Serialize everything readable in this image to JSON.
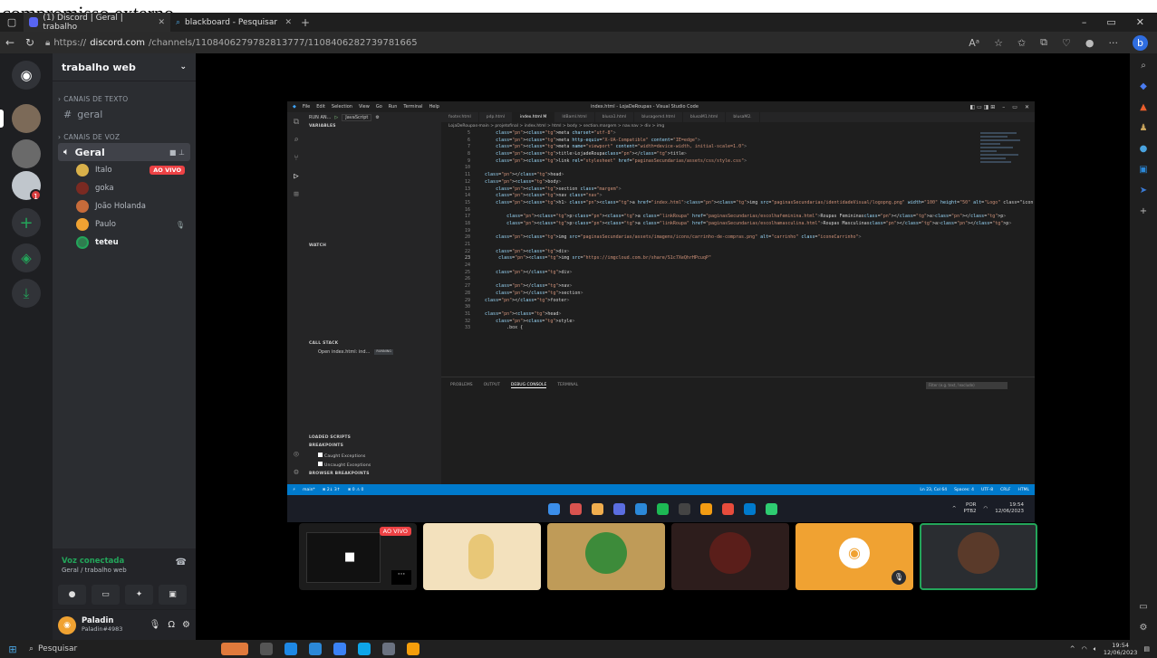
{
  "clip_text": "compromisso externo.",
  "browser": {
    "tabs": [
      {
        "label": "(1) Discord | Geral | trabalho",
        "active": true
      },
      {
        "label": "blackboard - Pesquisar",
        "active": false
      }
    ],
    "url_prefix": "https://",
    "url_domain": "discord.com",
    "url_path": "/channels/1108406279782813777/1108406282739781665"
  },
  "discord": {
    "server_name": "trabalho web",
    "text_category": "CANAIS DE TEXTO",
    "text_channels": [
      {
        "name": "geral"
      }
    ],
    "voice_category": "CANAIS DE VOZ",
    "voice_channel": {
      "name": "Geral",
      "live_label": "AO VIVO"
    },
    "voice_users": [
      {
        "name": "Italo",
        "live": true,
        "color": "#d9b14a"
      },
      {
        "name": "goka",
        "live": false,
        "color": "#7a2a22"
      },
      {
        "name": "João Holanda",
        "live": false,
        "color": "#c76b3a"
      },
      {
        "name": "Paulo",
        "live": false,
        "muted": true,
        "color": "#f0a232"
      },
      {
        "name": "teteu",
        "live": false,
        "color": "#2f7d4f"
      }
    ],
    "server_badge": "1",
    "voice_status": {
      "title": "Voz conectada",
      "subtitle": "Geral / trabalho web"
    },
    "user": {
      "name": "Paladin",
      "tag": "Paladin#4983"
    }
  },
  "vscode": {
    "window_title": "index.html - LojaDeRoupas - Visual Studio Code",
    "menu": [
      "File",
      "Edit",
      "Selection",
      "View",
      "Go",
      "Run",
      "Terminal",
      "Help"
    ],
    "run_label": "RUN AN...",
    "run_config": "JavaScript",
    "tabs": [
      "footer.html",
      "pdp.html",
      "index.html M",
      "IdBaml.html",
      "blusa1.html",
      "blusagemd.html",
      "blusaM1.html",
      "blusaM2."
    ],
    "breadcrumb": "LojaDeRoupas-main > projetofinal > index.html > html > body > section.margem > nav.nav > div > img",
    "sections": {
      "variables": "VARIABLES",
      "watch": "WATCH",
      "call_stack": "CALL STACK",
      "loaded_scripts": "LOADED SCRIPTS",
      "breakpoints": "BREAKPOINTS",
      "browser_breakpoints": "BROWSER BREAKPOINTS"
    },
    "call_stack_item": "Open index.html: ind...",
    "call_stack_state": "RUNNING",
    "bp_caught": "Caught Exceptions",
    "bp_uncaught": "Uncaught Exceptions",
    "code_lines": [
      {
        "n": "5",
        "t": "      <meta charset=\"utf-8\">"
      },
      {
        "n": "6",
        "t": "      <meta http-equiv=\"X-UA-Compatible\" content=\"IE=edge\">"
      },
      {
        "n": "7",
        "t": "      <meta name=\"viewport\" content=\"width=device-width, initial-scale=1.0\">"
      },
      {
        "n": "8",
        "t": "      <title>LojadeRoupa</title>"
      },
      {
        "n": "9",
        "t": "      <link rel=\"stylesheet\" href=\"paginasSecundarias/assets/css/style.css\">"
      },
      {
        "n": "10",
        "t": ""
      },
      {
        "n": "11",
        "t": "  </head>"
      },
      {
        "n": "12",
        "t": "  <body>"
      },
      {
        "n": "13",
        "t": "      <section class=\"margem\">"
      },
      {
        "n": "14",
        "t": "      <nav class=\"nav\">"
      },
      {
        "n": "15",
        "t": "      <h1> <a href=\"index.html\"><img src=\"paginasSecundarias/identidadeVisual/logopng.png\" width=\"100\" height=\"50\" alt=\"Logo\" class=\"icon"
      },
      {
        "n": "16",
        "t": ""
      },
      {
        "n": "17",
        "t": "          <p><a class=\"linkRoupa\" href=\"paginasSecundarias/escolhafeminina.html\">Roupas Femininas</a></p>"
      },
      {
        "n": "18",
        "t": "          <p><a class=\"linkRoupa\" href=\"paginasSecundarias/escolhamasculina.html\">Roupas Masculinas</a></p>"
      },
      {
        "n": "19",
        "t": ""
      },
      {
        "n": "20",
        "t": "      <img src=\"paginasSecundarias/assets/imagens/icons/carrinho-de-compras.png\" alt=\"carrinho\" class=\"iconeCarrinho\">"
      },
      {
        "n": "21",
        "t": ""
      },
      {
        "n": "22",
        "t": "      <div>"
      },
      {
        "n": "23",
        "t": "       <img src=\"https://imgcloud.com.br/share/S1c7XeQhrHPcuqP\""
      },
      {
        "n": "24",
        "t": ""
      },
      {
        "n": "25",
        "t": "      </div>"
      },
      {
        "n": "26",
        "t": ""
      },
      {
        "n": "27",
        "t": "      </nav>"
      },
      {
        "n": "28",
        "t": "      </section>"
      },
      {
        "n": "29",
        "t": "  </footer>"
      },
      {
        "n": "30",
        "t": ""
      },
      {
        "n": "31",
        "t": "  <head>"
      },
      {
        "n": "32",
        "t": "      <style>"
      },
      {
        "n": "33",
        "t": "          .box {"
      }
    ],
    "current_line": "23",
    "panel_tabs": [
      "PROBLEMS",
      "OUTPUT",
      "DEBUG CONSOLE",
      "TERMINAL"
    ],
    "panel_active": "DEBUG CONSOLE",
    "panel_filter": "Filter (e.g. text, !exclude)",
    "status_left": [
      "main*",
      "⊗ 2↓ 3↑",
      "⊗ 0 ⚠ 0"
    ],
    "status_right": [
      "Ln 23, Col 64",
      "Spaces: 4",
      "UTF-8",
      "CRLF",
      "HTML"
    ]
  },
  "inner_taskbar": {
    "lang": "POR",
    "layout": "PTB2",
    "time": "19:54",
    "date": "12/06/2023"
  },
  "windows": {
    "search": "Pesquisar",
    "time": "19:54",
    "date": "12/06/2023"
  },
  "tiles": [
    {
      "type": "screen",
      "live": "AO VIVO",
      "bg": "#1c1c1c"
    },
    {
      "type": "avatar",
      "bg": "#f3e1bd"
    },
    {
      "type": "avatar",
      "bg": "#bf9b58"
    },
    {
      "type": "avatar",
      "bg": "#2d1d1c"
    },
    {
      "type": "discord",
      "bg": "#f0a232"
    },
    {
      "type": "avatar",
      "bg": "#2a2d31",
      "speaking": true
    }
  ]
}
